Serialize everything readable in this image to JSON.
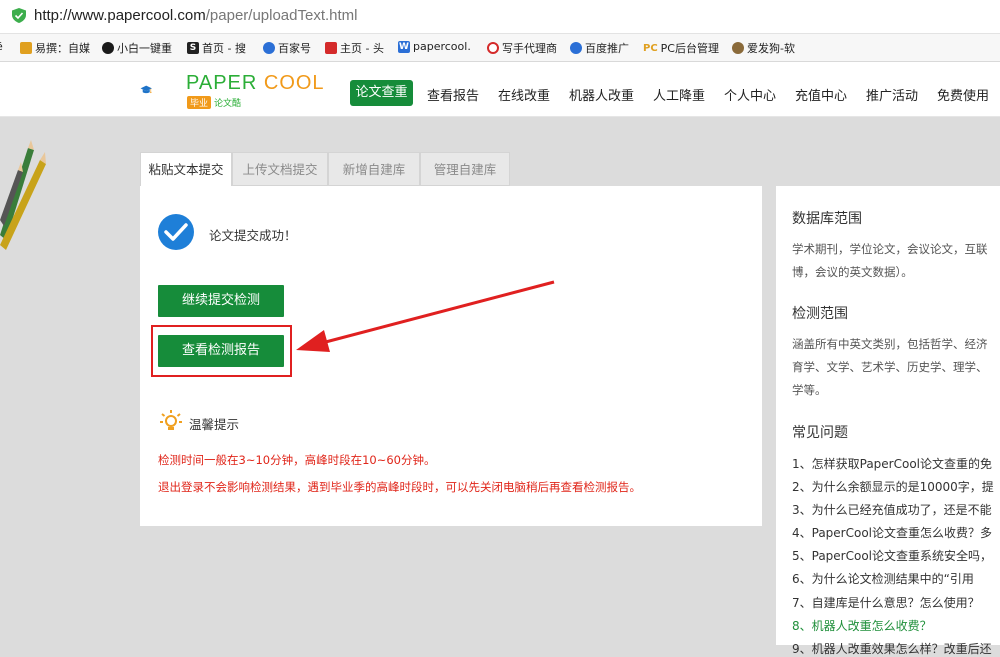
{
  "browser": {
    "url_host": "http://www.papercool.com",
    "url_path": "/paper/uploadText.html",
    "bookmarks": [
      {
        "label": "ē",
        "icon": "",
        "color": "#999999"
      },
      {
        "label": "易撰：自媒",
        "icon": "📦",
        "color": "#e0a020"
      },
      {
        "label": "小白一键重",
        "icon": "●",
        "color": "#1a1a1a"
      },
      {
        "label": "首页 - 搜",
        "icon": "S",
        "color": "#222222"
      },
      {
        "label": "百家号",
        "icon": "❀",
        "color": "#2b6fd6"
      },
      {
        "label": "主页 - 头",
        "icon": "头",
        "color": "#d42a2a"
      },
      {
        "label": "papercool.",
        "icon": "W",
        "color": "#2b6fd6"
      },
      {
        "label": "写手代理商",
        "icon": "◯",
        "color": "#d42a2a"
      },
      {
        "label": "百度推广",
        "icon": "❀",
        "color": "#2b6fd6"
      },
      {
        "label": "PC后台管理",
        "icon": "PC",
        "color": "#e0a020"
      },
      {
        "label": "爱发狗-软",
        "icon": "🐕",
        "color": "#555555"
      }
    ]
  },
  "site": {
    "logo_main_1": "PAPER ",
    "logo_main_2": "COOL",
    "logo_tag": "毕业",
    "logo_sub": "论文酷",
    "nav": [
      "论文查重",
      "查看报告",
      "在线改重",
      "机器人改重",
      "人工降重",
      "个人中心",
      "充值中心",
      "推广活动",
      "免费使用"
    ]
  },
  "tabs": [
    "粘贴文本提交",
    "上传文档提交",
    "新增自建库",
    "管理自建库"
  ],
  "main": {
    "success_text": "论文提交成功！",
    "continue_button": "继续提交检测",
    "view_report_button": "查看检测报告",
    "tip_title": "温馨提示",
    "tips": [
      "检测时间一般在3~10分钟，高峰时段在10~60分钟。",
      "退出登录不会影响检测结果，遇到毕业季的高峰时段时，可以先关闭电脑稍后再查看检测报告。"
    ]
  },
  "sidebar": {
    "db_title": "数据库范围",
    "db_lines": [
      "学术期刊，学位论文，会议论文，互联",
      "博，会议的英文数据）。"
    ],
    "scope_title": "检测范围",
    "scope_lines": [
      "涵盖所有中英文类别，包括哲学、经济",
      "育学、文学、艺术学、历史学、理学、",
      "学等。"
    ],
    "faq_title": "常见问题",
    "faq": [
      "1、怎样获取PaperCool论文查重的免",
      "2、为什么余额显示的是10000字，提",
      "3、为什么已经充值成功了，还是不能",
      "4、PaperCool论文查重怎么收费？多",
      "5、PaperCool论文查重系统安全吗，",
      "6、为什么论文检测结果中的“引用",
      "7、自建库是什么意思？怎么使用？",
      "8、机器人改重怎么收费？",
      "9、机器人改重效果怎么样？改重后还"
    ]
  },
  "colors": {
    "accent": "#168c3a",
    "warning": "#e0261a",
    "logo_green": "#2bae37",
    "logo_orange": "#f19a1a"
  }
}
